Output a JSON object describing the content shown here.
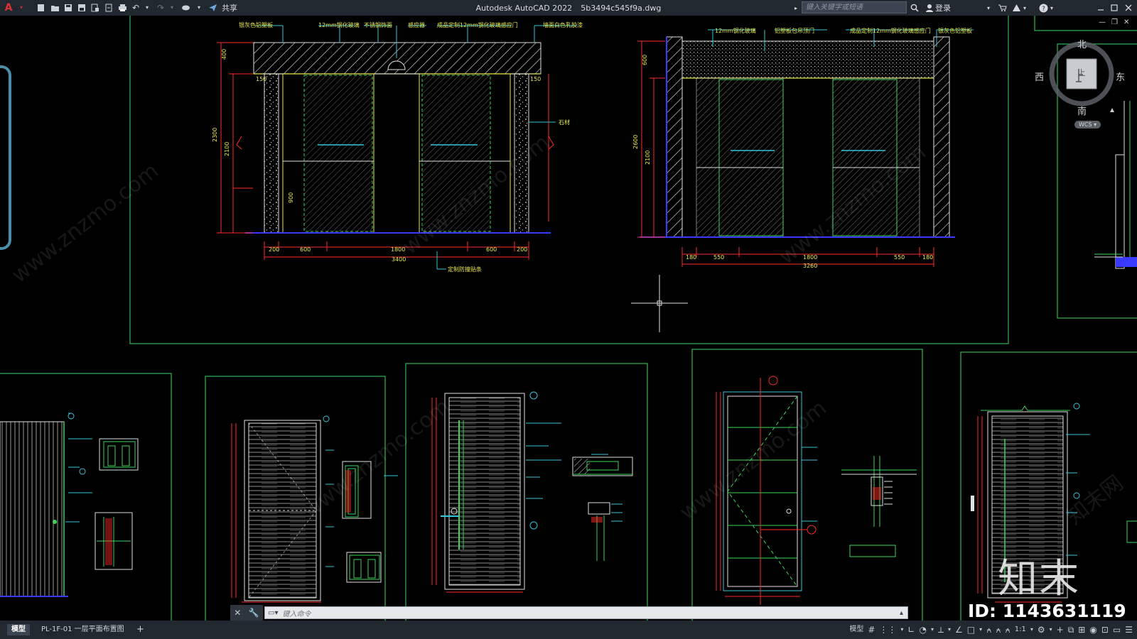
{
  "app": {
    "title": "Autodesk AutoCAD 2022",
    "file": "5b3494c545f9a.dwg",
    "share_label": "共享",
    "search_placeholder": "键入关键字或短语",
    "login_label": "登录"
  },
  "viewcube": {
    "north": "北",
    "south": "南",
    "east": "东",
    "west": "西",
    "top": "上",
    "wcs": "WCS"
  },
  "command": {
    "placeholder": "键入命令"
  },
  "status": {
    "tabs": [
      "模型",
      "PL-1F-01 一层平面布置图"
    ],
    "add_tab": "+",
    "model_label": "模型",
    "scale": "1:1"
  },
  "drawing": {
    "elevation1": {
      "labels": [
        "银灰色铝塑板",
        "12mm钢化玻璃",
        "不锈钢饰面",
        "感应器",
        "成品定制12mm钢化玻璃感应门",
        "墙面白色乳胶漆",
        "石材",
        "定制防撞贴条"
      ],
      "dims_bottom": [
        "200",
        "600",
        "1800",
        "600",
        "200"
      ],
      "dims_total": "3400",
      "dims_left": [
        "400",
        "2300",
        "2100",
        "900"
      ],
      "dims_small": [
        "150",
        "150"
      ]
    },
    "elevation2": {
      "labels": [
        "12mm钢化玻璃",
        "铝塑板包吊顶门",
        "成品定制12mm钢化玻璃感应门",
        "银灰色铝塑板"
      ],
      "dims_bottom": [
        "180",
        "550",
        "1800",
        "550",
        "180"
      ],
      "dims_total": "3260",
      "dims_left": [
        "600",
        "2600",
        "2100"
      ]
    }
  },
  "watermark": {
    "text": "www.znzmo.com",
    "brand": "知末网",
    "logo": "知末",
    "id": "ID: 1143631119"
  },
  "colors": {
    "titlebar": "#212830",
    "frame": "#2fa84f",
    "red": "#ff2a2a",
    "yellow": "#e8e84a",
    "cyan": "#35c6d8",
    "blue": "#3a3aff",
    "green": "#39d65a",
    "white": "#e0e0e0"
  }
}
